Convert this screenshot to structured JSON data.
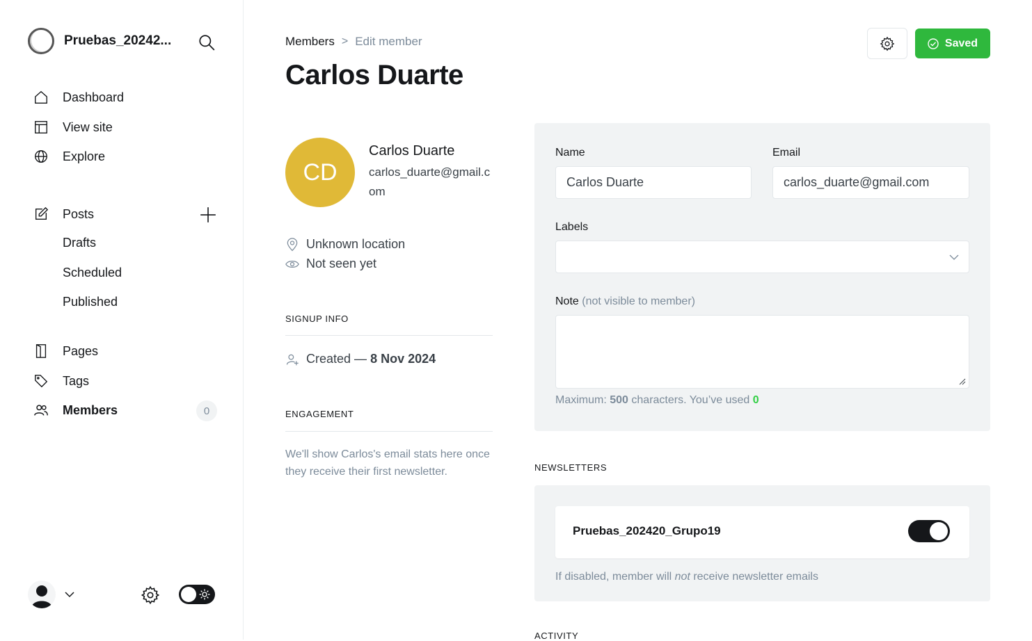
{
  "sidebar": {
    "site_name": "Pruebas_20242...",
    "nav": {
      "dashboard": "Dashboard",
      "view_site": "View site",
      "explore": "Explore",
      "posts": "Posts",
      "drafts": "Drafts",
      "scheduled": "Scheduled",
      "published": "Published",
      "pages": "Pages",
      "tags": "Tags",
      "members": "Members",
      "members_count": "0"
    }
  },
  "header": {
    "breadcrumb_parent": "Members",
    "breadcrumb_sep": ">",
    "breadcrumb_current": "Edit member",
    "title": "Carlos Duarte",
    "saved_label": "Saved"
  },
  "member": {
    "initials": "CD",
    "name": "Carlos Duarte",
    "email": "carlos_duarte@gmail.com",
    "location": "Unknown location",
    "last_seen": "Not seen yet",
    "avatar_color": "#e0b937"
  },
  "signup": {
    "label": "SIGNUP INFO",
    "created_prefix": "Created —",
    "created_date": "8 Nov 2024"
  },
  "engagement": {
    "label": "ENGAGEMENT",
    "text": "We'll show Carlos's email stats here once they receive their first newsletter."
  },
  "form": {
    "name_label": "Name",
    "name_value": "Carlos Duarte",
    "email_label": "Email",
    "email_value": "carlos_duarte@gmail.com",
    "labels_label": "Labels",
    "note_label": "Note",
    "note_hint": "(not visible to member)",
    "max_prefix": "Maximum:",
    "max_value": "500",
    "max_mid": "characters. You’ve used",
    "used_value": "0"
  },
  "newsletters": {
    "label": "NEWSLETTERS",
    "items": [
      {
        "name": "Pruebas_202420_Grupo19",
        "enabled": true
      }
    ],
    "hint_before": "If disabled, member will",
    "hint_em": "not",
    "hint_after": "receive newsletter emails"
  },
  "activity": {
    "label": "ACTIVITY"
  },
  "colors": {
    "accent_green": "#30cf43",
    "text_dark": "#15171a",
    "muted": "#7c8b9a",
    "panel_bg": "#f1f3f4"
  }
}
